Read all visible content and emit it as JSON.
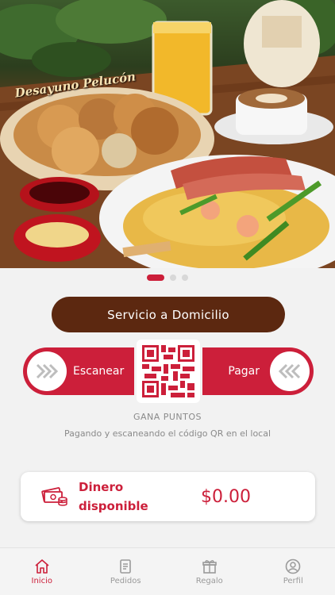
{
  "hero": {
    "caption": "Desayuno Pelucón",
    "slides": 3,
    "active_slide": 1
  },
  "delivery_button": {
    "label": "Servicio a Domicilio"
  },
  "actions": {
    "scan_label": "Escanear",
    "pay_label": "Pagar"
  },
  "points": {
    "title": "GANA PUNTOS",
    "subtitle": "Pagando y escaneando el código QR en el local"
  },
  "balance": {
    "label": "Dinero disponible",
    "value": "$0.00"
  },
  "nav": {
    "items": [
      {
        "label": "Inicio",
        "icon": "home-icon",
        "active": true
      },
      {
        "label": "Pedidos",
        "icon": "orders-icon",
        "active": false
      },
      {
        "label": "Regalo",
        "icon": "gift-icon",
        "active": false
      },
      {
        "label": "Perfil",
        "icon": "profile-icon",
        "active": false
      }
    ]
  },
  "colors": {
    "accent": "#cc1f3a",
    "brown": "#5c2810",
    "background": "#f2f2f2"
  }
}
